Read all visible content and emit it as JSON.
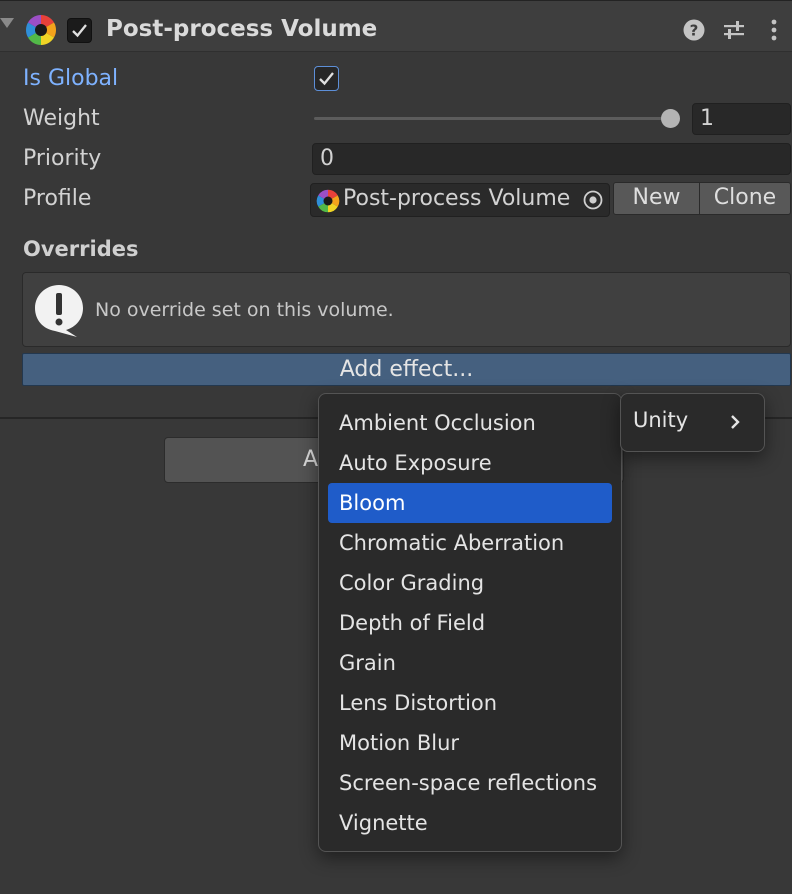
{
  "header": {
    "title": "Post-process Volume",
    "enabled": true,
    "icons": [
      "help-icon",
      "presets-icon",
      "more-icon"
    ]
  },
  "fields": {
    "is_global_label": "Is Global",
    "is_global_checked": true,
    "weight_label": "Weight",
    "weight_value": "1",
    "weight_fraction": 1.0,
    "priority_label": "Priority",
    "priority_value": "0",
    "profile_label": "Profile",
    "profile_value": "Post-process Volume",
    "new_label": "New",
    "clone_label": "Clone"
  },
  "overrides": {
    "label": "Overrides",
    "message": "No override set on this volume.",
    "add_effect_label": "Add effect..."
  },
  "background_button": {
    "label": "A"
  },
  "menu": {
    "items": [
      "Ambient Occlusion",
      "Auto Exposure",
      "Bloom",
      "Chromatic Aberration",
      "Color Grading",
      "Depth of Field",
      "Grain",
      "Lens Distortion",
      "Motion Blur",
      "Screen-space reflections",
      "Vignette"
    ],
    "selected_index": 2,
    "submenu_label": "Unity"
  },
  "colors": {
    "accent": "#1f5cc9",
    "link_blue": "#7eb2ff",
    "add_effect": "#45607f"
  }
}
